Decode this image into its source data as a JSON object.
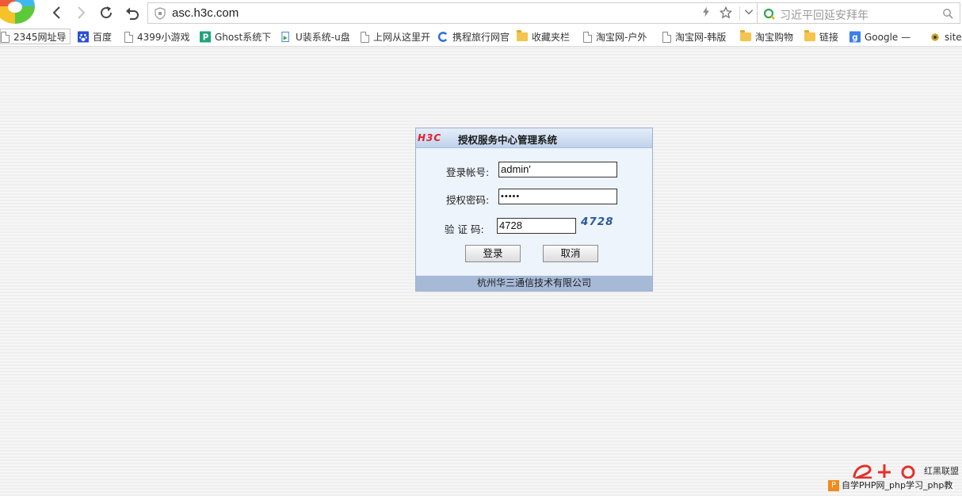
{
  "browser": {
    "url": "asc.h3c.com",
    "search_placeholder": "习近平回延安拜年"
  },
  "bookmarks": [
    {
      "label": "2345网址导",
      "icon": "page-icon"
    },
    {
      "label": "百度",
      "icon": "baidu-paw-icon"
    },
    {
      "label": "4399小游戏",
      "icon": "page-icon"
    },
    {
      "label": "Ghost系统下",
      "icon": "ghost-p-icon"
    },
    {
      "label": "U装系统-u盘",
      "icon": "u-install-icon"
    },
    {
      "label": "上网从这里开",
      "icon": "page-icon"
    },
    {
      "label": "携程旅行网官",
      "icon": "ctrip-icon"
    },
    {
      "label": "收藏夹栏",
      "icon": "folder-icon"
    },
    {
      "label": "淘宝网-户外",
      "icon": "page-icon"
    },
    {
      "label": "淘宝网-韩版",
      "icon": "page-icon"
    },
    {
      "label": "淘宝购物",
      "icon": "folder-icon"
    },
    {
      "label": "链接",
      "icon": "folder-icon"
    },
    {
      "label": "Google —",
      "icon": "google-icon"
    },
    {
      "label": "site:",
      "icon": "site-icon"
    }
  ],
  "login": {
    "logo": "H3C",
    "title": "授权服务中心管理系统",
    "account_label": "登录帐号:",
    "account_value": "admin'",
    "password_label": "授权密码:",
    "password_value": "•••••",
    "captcha_label": "验 证 码:",
    "captcha_value": "4728",
    "captcha_image_text": "4728",
    "login_button": "登录",
    "cancel_button": "取消",
    "footer": "杭州华三通信技术有限公司"
  },
  "watermark": {
    "side_text": "红黑联盟",
    "bottom_text": "自学PHP网_php学习_php教"
  },
  "colors": {
    "panel_header": "#bfd2eb",
    "panel_body": "#eef4fb",
    "panel_footer": "#a6b9d6",
    "logo_red": "#e0202a",
    "captcha_blue": "#2b5a9c"
  }
}
